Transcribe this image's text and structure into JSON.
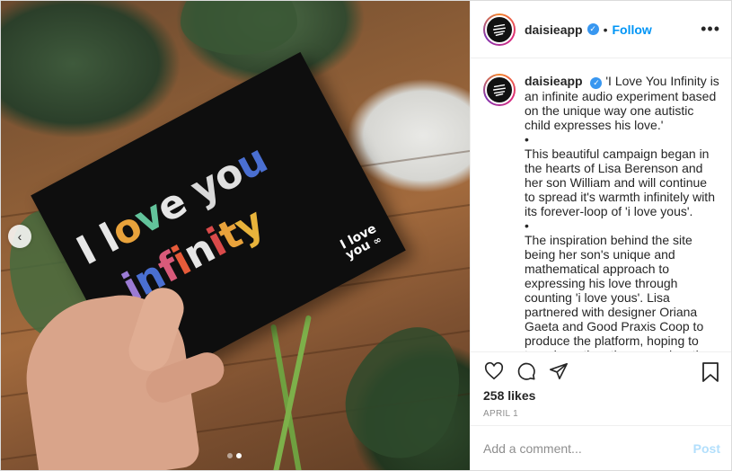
{
  "media": {
    "card_line1": [
      {
        "text": "I",
        "color": "#e6e6e6"
      },
      {
        "text": " ",
        "color": "#ffffff"
      },
      {
        "text": "l",
        "color": "#e6e6e6"
      },
      {
        "text": "o",
        "color": "#e8a23b"
      },
      {
        "text": "v",
        "color": "#62c39b"
      },
      {
        "text": "e",
        "color": "#e6e6e6"
      },
      {
        "text": " ",
        "color": "#ffffff"
      },
      {
        "text": "y",
        "color": "#d9d9d9"
      },
      {
        "text": "o",
        "color": "#e0e0e0"
      },
      {
        "text": "u",
        "color": "#4a6fd1"
      }
    ],
    "card_line2": [
      {
        "text": "i",
        "color": "#9b7bd4"
      },
      {
        "text": "n",
        "color": "#4a6fd1"
      },
      {
        "text": "f",
        "color": "#d95a7a"
      },
      {
        "text": "i",
        "color": "#e65b3a"
      },
      {
        "text": "n",
        "color": "#e6e6e6"
      },
      {
        "text": "i",
        "color": "#d94a4a"
      },
      {
        "text": "t",
        "color": "#e8a23b"
      },
      {
        "text": "y",
        "color": "#e8b33b"
      }
    ],
    "card_logo_line1": "I love",
    "card_logo_line2": "you",
    "slide_count": 2,
    "active_slide": 2
  },
  "header": {
    "username": "daisieapp",
    "separator": "•",
    "follow_label": "Follow",
    "more_label": "•••"
  },
  "caption": {
    "username": "daisieapp",
    "paragraphs": [
      "'I Love You Infinity is an infinite audio experiment based on the unique way one autistic child expresses his love.'",
      "•",
      "This beautiful campaign began in the hearts of Lisa Berenson and her son William and will continue to spread it's warmth infinitely with its forever-loop of 'i love yous'.",
      "•",
      "The inspiration behind the site being her son's unique and mathematical approach to expressing his love through counting 'i love yous'. Lisa partnered with designer Oriana Gaeta and Good Praxis Coop to produce the platform, hoping to tear down the stigmas and myths surrounding Autism and lack of information!"
    ]
  },
  "stats": {
    "likes": "258 likes",
    "date": "APRIL 1"
  },
  "comment": {
    "placeholder": "Add a comment...",
    "post_label": "Post"
  },
  "colors": {
    "accent": "#0095f6",
    "post_disabled": "#b2dffc",
    "verified": "#3897f0"
  }
}
